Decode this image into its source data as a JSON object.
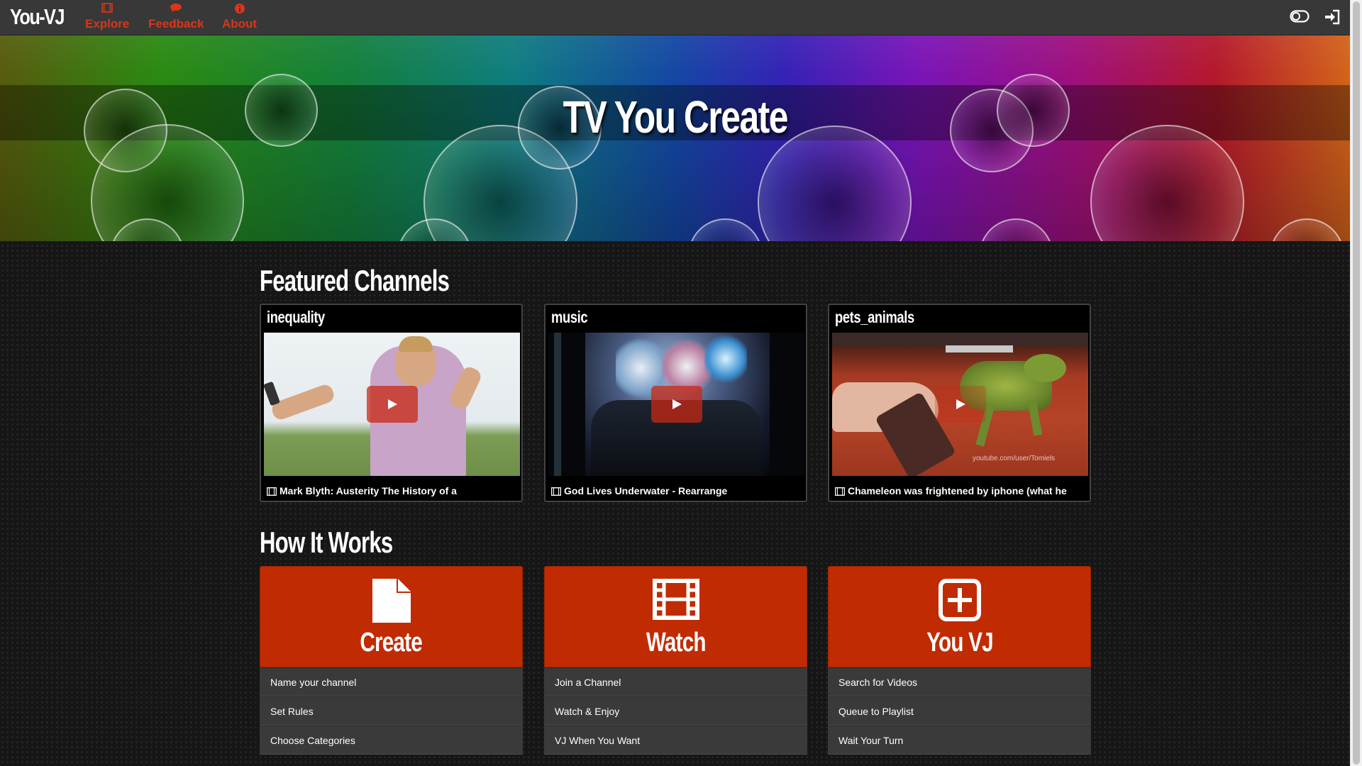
{
  "brand": "You-VJ",
  "nav": {
    "explore": "Explore",
    "feedback": "Feedback",
    "about": "About",
    "right_icons": [
      "toggle-icon",
      "sign-in-icon"
    ]
  },
  "hero": {
    "title": "TV You Create"
  },
  "featured": {
    "title": "Featured Channels",
    "channels": [
      {
        "name": "inequality",
        "video": "Mark Blyth: Austerity The History of a"
      },
      {
        "name": "music",
        "video": "God Lives Underwater - Rearrange"
      },
      {
        "name": "pets_animals",
        "video": "Chameleon was frightened by iphone (what he",
        "watermark": "youtube.com/user/Tomiels"
      }
    ]
  },
  "how": {
    "title": "How It Works",
    "steps": [
      {
        "label": "Create",
        "icon": "file-icon",
        "items": [
          "Name your channel",
          "Set Rules",
          "Choose Categories"
        ]
      },
      {
        "label": "Watch",
        "icon": "film-icon",
        "items": [
          "Join a Channel",
          "Watch & Enjoy",
          "VJ When You Want"
        ]
      },
      {
        "label": "You VJ",
        "icon": "plus-square-icon",
        "items": [
          "Search for Videos",
          "Queue to Playlist",
          "Wait Your Turn"
        ]
      }
    ]
  },
  "colors": {
    "accent": "#c12b02",
    "nav_link": "#d9361a",
    "navbar": "#383838"
  }
}
